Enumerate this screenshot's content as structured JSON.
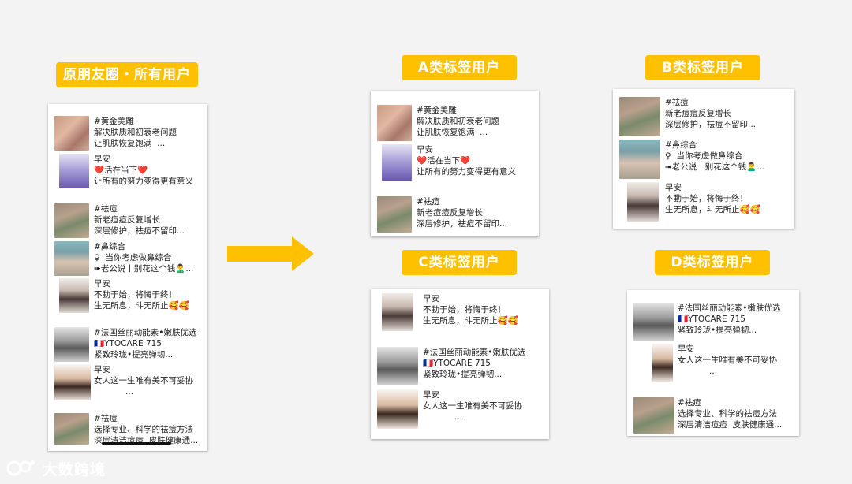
{
  "tags": {
    "original": "原朋友圈・所有用户",
    "a": "A类标签用户",
    "b": "B类标签用户",
    "c": "C类标签用户",
    "d": "D类标签用户"
  },
  "posts": {
    "gold": [
      "#黄金美雕",
      "解决肤质和初衰老问题",
      "让肌肤恢复饱满  ..."
    ],
    "morning1": [
      "早安",
      "❤️活在当下❤️",
      "让所有的努力变得更有意义"
    ],
    "acne1": [
      "#祛痘",
      "新老痘痘反复增长",
      "深层修护，祛痘不留印..."
    ],
    "nose": [
      "#鼻综合",
      "♀  当你考虑做鼻综合",
      "➠老公说丨别花这个钱🙎‍♂️..."
    ],
    "morning2": [
      "早安",
      "不動于始，将悔于终！",
      "生无所息，斗无所止🥰🥰"
    ],
    "france": [
      "#法国丝丽动能素•嫩肤优选",
      "🇫🇷YTOCARE 715",
      "紧致玲珑•提亮弹韧..."
    ],
    "morning3": [
      "早安",
      "女人这一生唯有美不可妥协",
      "            ..."
    ],
    "acne2": [
      "#祛痘",
      "选择专业、科学的祛痘方法",
      "深层清洁痘痘  皮肤健康通..."
    ]
  },
  "logo": {
    "text": "大数跨境"
  },
  "colors": {
    "accent": "#ffc000",
    "background": "#f3f3f3"
  }
}
